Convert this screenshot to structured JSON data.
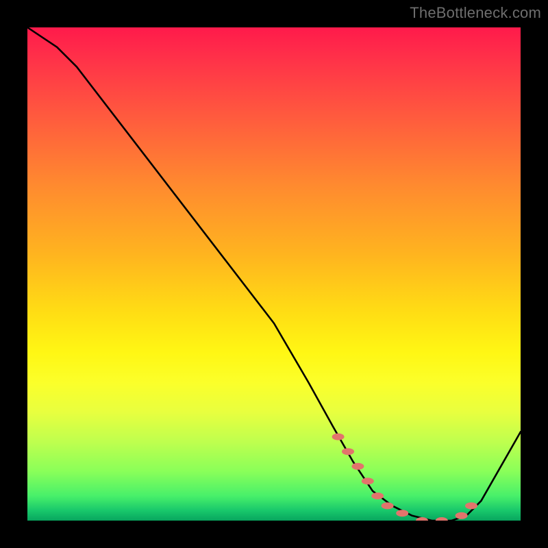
{
  "watermark": "TheBottleneck.com",
  "chart_data": {
    "type": "line",
    "title": "",
    "xlabel": "",
    "ylabel": "",
    "xlim": [
      0,
      100
    ],
    "ylim": [
      0,
      100
    ],
    "grid": false,
    "legend": false,
    "series": [
      {
        "name": "bottleneck-curve",
        "x": [
          0,
          6,
          10,
          20,
          30,
          40,
          50,
          57,
          62,
          66,
          70,
          74,
          78,
          82,
          86,
          89,
          92,
          100
        ],
        "values": [
          100,
          96,
          92,
          79,
          66,
          53,
          40,
          28,
          19,
          12,
          6,
          3,
          1,
          0,
          0,
          1,
          4,
          18
        ]
      }
    ],
    "markers": {
      "name": "highlight-band",
      "color": "#e2746c",
      "x": [
        63,
        65,
        67,
        69,
        71,
        73,
        76,
        80,
        84,
        88,
        90
      ],
      "values": [
        17,
        14,
        11,
        8,
        5,
        3,
        1.5,
        0,
        0,
        1,
        3
      ]
    },
    "gradient": {
      "orientation": "vertical",
      "stops": [
        {
          "pos": 0.0,
          "color": "#ff1a4b"
        },
        {
          "pos": 0.18,
          "color": "#ff5a3e"
        },
        {
          "pos": 0.46,
          "color": "#ffb41f"
        },
        {
          "pos": 0.66,
          "color": "#fff714"
        },
        {
          "pos": 0.84,
          "color": "#bfff4e"
        },
        {
          "pos": 0.95,
          "color": "#48f06a"
        },
        {
          "pos": 1.0,
          "color": "#08a55e"
        }
      ]
    }
  }
}
